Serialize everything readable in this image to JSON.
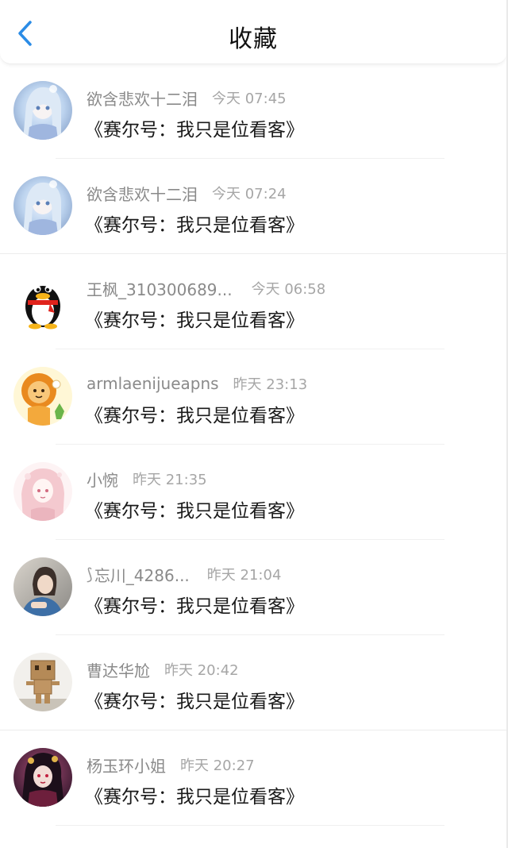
{
  "header": {
    "title": "收藏",
    "back_icon": "chevron-left-icon",
    "accent": "#2b8ce6"
  },
  "items": [
    {
      "user": "欲含悲欢十二泪",
      "time": "今天 07:45",
      "text": "《赛尔号：我只是位看客》",
      "avatar": "anime-girl-blue"
    },
    {
      "user": "欲含悲欢十二泪",
      "time": "今天 07:24",
      "text": "《赛尔号：我只是位看客》",
      "avatar": "anime-girl-blue"
    },
    {
      "user": "王枫_310300689...",
      "time": "今天 06:58",
      "text": "《赛尔号：我只是位看客》",
      "avatar": "qq-penguin"
    },
    {
      "user": "armlaenijueapns",
      "time": "昨天 23:13",
      "text": "《赛尔号：我只是位看客》",
      "avatar": "cartoon-lion"
    },
    {
      "user": "小惋",
      "time": "昨天 21:35",
      "text": "《赛尔号：我只是位看客》",
      "avatar": "anime-girl-pink"
    },
    {
      "user": "忘川_4286...",
      "time": "昨天 21:04",
      "text": "《赛尔号：我只是位看客》",
      "avatar": "girl-photo"
    },
    {
      "user": "曹达华尬",
      "time": "昨天 20:42",
      "text": "《赛尔号：我只是位看客》",
      "avatar": "danbo-box-robot"
    },
    {
      "user": "杨玉环小姐",
      "time": "昨天 20:27",
      "text": "《赛尔号：我只是位看客》",
      "avatar": "anime-dark-character"
    }
  ]
}
